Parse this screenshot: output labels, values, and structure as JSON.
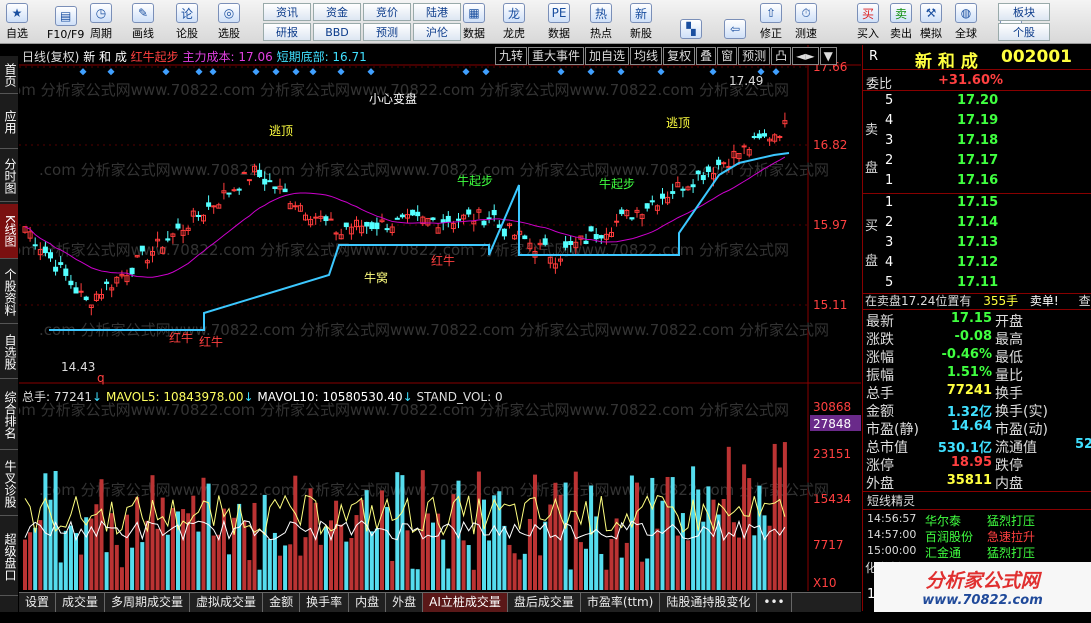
{
  "toolbar": {
    "buttons": [
      {
        "label": "自选",
        "icon": "star-icon"
      },
      {
        "label": "F10/F9",
        "icon": "f10-icon"
      },
      {
        "label": "周期",
        "icon": "clock-icon"
      },
      {
        "label": "画线",
        "icon": "pen-icon"
      },
      {
        "label": "论股",
        "icon": "discuss-icon"
      },
      {
        "label": "选股",
        "icon": "select-stock-icon"
      },
      {
        "label": "数据",
        "icon": "data-icon"
      },
      {
        "label": "龙虎",
        "icon": "dragon-tiger-icon"
      },
      {
        "label": "数据",
        "icon": "pe-icon"
      },
      {
        "label": "热点",
        "icon": "hot-icon"
      },
      {
        "label": "新股",
        "icon": "ipo-icon"
      },
      {
        "label": "",
        "icon": "windows-icon"
      },
      {
        "label": "",
        "icon": "back-arrow-icon"
      },
      {
        "label": "修正",
        "icon": "up-arrow-icon"
      },
      {
        "label": "测速",
        "icon": "speed-test-icon"
      },
      {
        "label": "买入",
        "icon": "buy-icon"
      },
      {
        "label": "卖出",
        "icon": "sell-icon"
      },
      {
        "label": "模拟",
        "icon": "simulate-icon"
      },
      {
        "label": "全球",
        "icon": "globe-icon"
      },
      {
        "label": "",
        "icon": "bulb-icon"
      }
    ],
    "small": [
      [
        "资讯",
        "资金",
        "竞价",
        "陆港"
      ],
      [
        "研报",
        "BBD",
        "预测",
        "沪伦"
      ]
    ],
    "small_right": [
      "板块",
      "个股"
    ],
    "buy_sym": "买",
    "sell_sym": "卖"
  },
  "leftnav": [
    "首页",
    "应用",
    "分时图",
    "K线图",
    "个股资料",
    "自选股",
    "综合排名",
    "牛叉诊股",
    "超级盘口"
  ],
  "kinfo": {
    "t1": "日线(复权)",
    "t2": "新 和 成",
    "t3": "红牛起步",
    "t4": "主力成本: 17.06",
    "t5": "短期底部: 16.71"
  },
  "topbtns": [
    "九转",
    "重大事件",
    "加自选",
    "均线",
    "复权",
    "叠",
    "窗",
    "预测",
    "凸",
    "◄►",
    "▼"
  ],
  "ytop": [
    "17.66",
    "16.82",
    "15.97",
    "15.11"
  ],
  "ybot": [
    "30868",
    "27848",
    "23151",
    "15434",
    "7717",
    "X10"
  ],
  "annot": {
    "small": "小心变盘",
    "top1": "逃顶",
    "top2": "逃顶",
    "hi": "17.49",
    "lo": "14.43",
    "hn1": "红牛",
    "hn2": "红牛",
    "hn3": "红牛",
    "nw": "牛窝",
    "qb": "牛起步",
    "qb2": "牛起步",
    "q": "q"
  },
  "volinfo": {
    "a": "总手: 77241",
    "b": "MAVOL5: 10843978.00",
    "c": "MAVOL10: 10580530.40",
    "d": "STAND_VOL: 0"
  },
  "bottomtabs": [
    "设置",
    "成交量",
    "多周期成交量",
    "虚拟成交量",
    "金额",
    "换手率",
    "内盘",
    "外盘",
    "AI立桩成交量",
    "盘后成交量",
    "市盈率(ttm)",
    "陆股通持股变化",
    "•••"
  ],
  "quote": {
    "r": "R",
    "name": "新 和 成",
    "code": "002001",
    "weibi_label": "委比",
    "weibi": "+31.60%",
    "sell_label": [
      "卖",
      "盘"
    ],
    "sell": [
      [
        "5",
        "17.20"
      ],
      [
        "4",
        "17.19"
      ],
      [
        "3",
        "17.18"
      ],
      [
        "2",
        "17.17"
      ],
      [
        "1",
        "17.16"
      ]
    ],
    "buy_label": [
      "买",
      "盘"
    ],
    "buy": [
      [
        "1",
        "17.15"
      ],
      [
        "2",
        "17.14"
      ],
      [
        "3",
        "17.13"
      ],
      [
        "4",
        "17.12"
      ],
      [
        "5",
        "17.11"
      ]
    ],
    "notice": "在卖盘17.24位置有",
    "notice_qty": "355手",
    "notice_end": "卖单!",
    "notice_tail": "查",
    "stats": [
      [
        "最新",
        "17.15",
        "开盘",
        ""
      ],
      [
        "涨跌",
        "-0.08",
        "最高",
        ""
      ],
      [
        "涨幅",
        "-0.46%",
        "最低",
        ""
      ],
      [
        "振幅",
        "1.51%",
        "量比",
        ""
      ],
      [
        "总手",
        "77241",
        "换手",
        ""
      ],
      [
        "金额",
        "1.32亿",
        "换手(实)",
        ""
      ],
      [
        "市盈(静)",
        "14.64",
        "市盈(动)",
        ""
      ],
      [
        "总市值",
        "530.1亿",
        "流通值",
        "52"
      ],
      [
        "涨停",
        "18.95",
        "跌停",
        ""
      ],
      [
        "外盘",
        "35811",
        "内盘",
        ""
      ]
    ],
    "jl_title": "短线精灵",
    "jl": [
      [
        "14:56:57",
        "华尔泰",
        "猛烈打压"
      ],
      [
        "14:57:00",
        "百润股份",
        "急速拉升"
      ],
      [
        "15:00:00",
        "汇金通",
        "猛烈打压"
      ]
    ],
    "hs": "化学制",
    "num15": "15"
  },
  "watermark": {
    "text": "分析家公式网",
    "url": "www.70822.com"
  },
  "colors": {
    "up": "#ff3c3c",
    "down": "#54ffff",
    "ma": "#cc00cc",
    "step": "#3cc8ff"
  }
}
